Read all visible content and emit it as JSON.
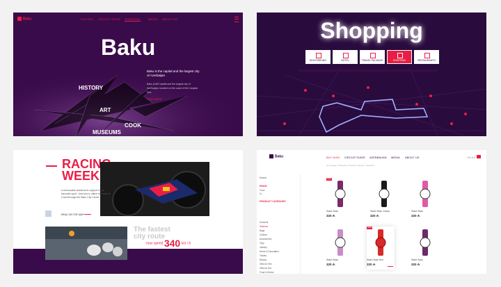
{
  "panel1": {
    "logo": "Baku",
    "menu": [
      "HISTORY",
      "CIRCUIT GUIDE",
      "SHOPPING",
      "MEDIA",
      "ABOUT US"
    ],
    "title": "Baku",
    "intro_title": "Baku is the capital and the largest city of Azerbaijan",
    "intro_body": "Baku is the capital and the largest city of Azerbaijan, located on the coast of the Caspian Sea.",
    "read_more": "READ MORE",
    "categories": [
      "HISTORY",
      "ART",
      "COOK",
      "MUSEUMS"
    ]
  },
  "panel2": {
    "title": "Shopping",
    "categories": [
      "SIGHTSEEING",
      "HOTEL",
      "TRAVEL PACKAGE",
      "SHOPPING",
      "RESTAURANTS"
    ]
  },
  "panel3": {
    "title_line1": "RACING",
    "title_line2": "WEEKEND",
    "body": "A memorable weekend in support of our favourite sport. Just how to utilize the most of it and through the Baku City Circuit.",
    "link": "READ ON THE MAP",
    "fastest_line1": "The fastest",
    "fastest_line2": "city route",
    "max_speed_label": "max speed",
    "max_speed_value": "340",
    "max_speed_unit": "km / h"
  },
  "panel4": {
    "logo": "Baku",
    "nav": [
      "BUY NOW",
      "CIRCUIT GUIDE",
      "AZERBAIJAN",
      "MEDIA",
      "ABOUT US"
    ],
    "lang": "EN AZ",
    "breadcrumb": "Homepage / Shopping / Product category / Watches",
    "sidebar": {
      "search": "Search",
      "price_label": "PRICE",
      "price_from": "From",
      "price_to": "To",
      "category_label": "PRODUCT CATEGORY",
      "items": [
        "Souvenir",
        "Watches",
        "Bags",
        "Clothes",
        "Accessories",
        "Toys",
        "Jewelry",
        "Home & Decoration",
        "Tickets",
        "Beauty",
        "Gifts for Him",
        "Gifts for Her",
        "Food & Drinks"
      ]
    },
    "products": [
      {
        "name": "Watch Baku",
        "price": "320 ₼",
        "sale": "SALE",
        "color": "#7b2a6b"
      },
      {
        "name": "Watch Baku Classic",
        "price": "320 ₼",
        "sale": "",
        "color": "#1a1a1a"
      },
      {
        "name": "Watch Baku",
        "price": "320 ₼",
        "sale": "",
        "color": "#e05aa8"
      },
      {
        "name": "Watch Baku",
        "price": "320 ₼",
        "sale": "",
        "color": "#c98cc7"
      },
      {
        "name": "Watch Baku Red",
        "price": "320 ₼",
        "sale": "SALE",
        "color": "#d82a2a"
      },
      {
        "name": "Watch Baku",
        "price": "320 ₼",
        "sale": "",
        "color": "#6b2a6b"
      }
    ]
  }
}
